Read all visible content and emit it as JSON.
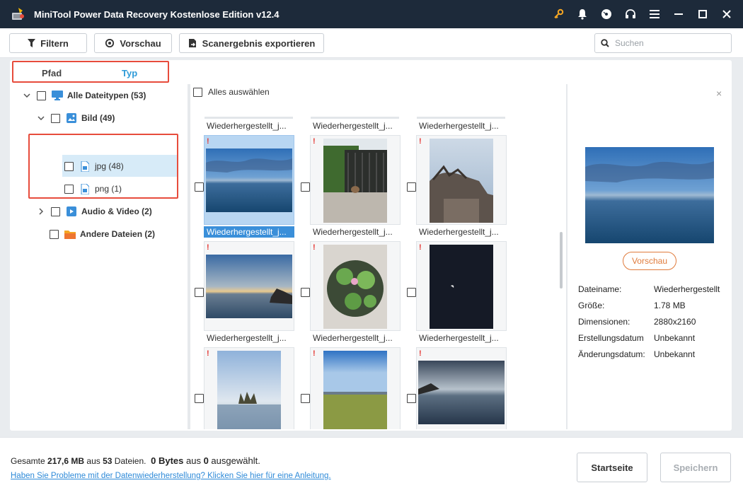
{
  "window": {
    "title": "MiniTool Power Data Recovery Kostenlose Edition v12.4",
    "icons": [
      "key-icon",
      "bell-icon",
      "disc-icon",
      "headphones-icon",
      "menu-icon",
      "minimize-icon",
      "maximize-icon",
      "close-icon"
    ]
  },
  "toolbar": {
    "filter_label": "Filtern",
    "preview_label": "Vorschau",
    "export_label": "Scanergebnis exportieren",
    "search_placeholder": "Suchen"
  },
  "tabs": {
    "path": "Pfad",
    "type": "Typ",
    "active": "Typ"
  },
  "tree": {
    "all": "Alle Dateitypen (53)",
    "image": "Bild (49)",
    "jpg": "jpg (48)",
    "png": "png (1)",
    "audio_video": "Audio & Video (2)",
    "other": "Andere Dateien (2)"
  },
  "grid": {
    "select_all": "Alles auswählen",
    "top_row_names": [
      "Wiederhergestellt_j...",
      "Wiederhergestellt_j...",
      "Wiederhergestellt_j..."
    ],
    "rows": [
      [
        "Wiederhergestellt_j...",
        "Wiederhergestellt_j...",
        "Wiederhergestellt_j..."
      ],
      [
        "Wiederhergestellt_j...",
        "Wiederhergestellt_j...",
        "Wiederhergestellt_j..."
      ]
    ],
    "warn_mark": "!",
    "selected_index": 0
  },
  "preview": {
    "button": "Vorschau",
    "close": "×",
    "fields": [
      {
        "label": "Dateiname:",
        "value": "Wiederhergestellt"
      },
      {
        "label": "Größe:",
        "value": "1.78 MB"
      },
      {
        "label": "Dimensionen:",
        "value": "2880x2160"
      },
      {
        "label": "Erstellungsdatum",
        "value": "Unbekannt"
      },
      {
        "label": "Änderungsdatum:",
        "value": "Unbekannt"
      }
    ]
  },
  "footer": {
    "total_prefix": "Gesamte ",
    "total_size": "217,6 MB",
    "total_mid": " aus ",
    "total_count": "53",
    "total_suffix": " Dateien.",
    "sel_size": "0 Bytes",
    "sel_mid": " aus ",
    "sel_count": "0",
    "sel_suffix": " ausgewählt.",
    "help_link": "Haben Sie Probleme mit der Datenwiederherstellung? Klicken Sie hier für eine Anleitung.",
    "home_button": "Startseite",
    "save_button": "Speichern"
  },
  "colors": {
    "titlebar": "#1d2a3a",
    "accent": "#2e9bd8",
    "highlight": "#e74c3c",
    "preview_btn": "#e07b3c"
  }
}
